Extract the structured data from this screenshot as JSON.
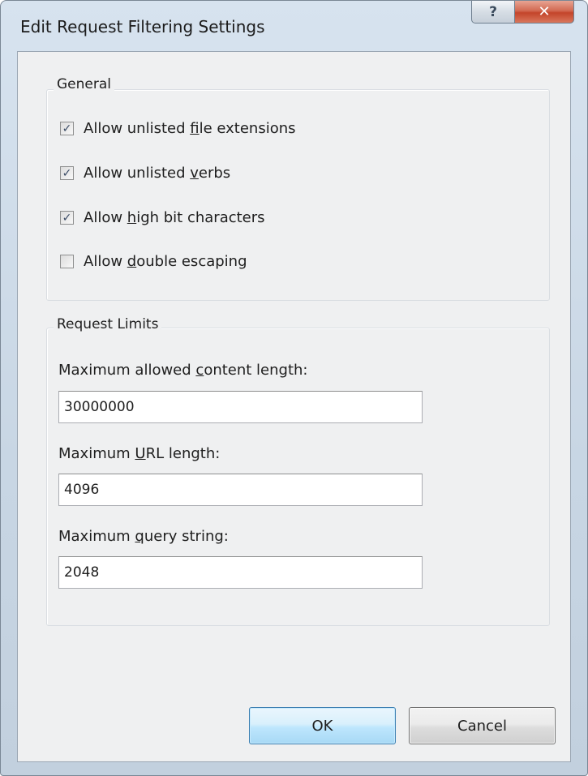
{
  "window": {
    "title": "Edit Request Filtering Settings",
    "help_glyph": "?",
    "close_glyph": "✕"
  },
  "general": {
    "label": "General",
    "options": [
      {
        "pre": "Allow unlisted ",
        "key": "f",
        "post": "ile extensions",
        "checked": true
      },
      {
        "pre": "Allow unlisted ",
        "key": "v",
        "post": "erbs",
        "checked": true
      },
      {
        "pre": "Allow ",
        "key": "h",
        "post": "igh bit characters",
        "checked": true
      },
      {
        "pre": "Allow ",
        "key": "d",
        "post": "ouble escaping",
        "checked": false
      }
    ]
  },
  "limits": {
    "label": "Request Limits",
    "fields": [
      {
        "pre": "Maximum allowed ",
        "key": "c",
        "post": "ontent length:",
        "value": "30000000"
      },
      {
        "pre": "Maximum ",
        "key": "U",
        "post": "RL length:",
        "value": "4096"
      },
      {
        "pre": "Maximum ",
        "key": "q",
        "post": "uery string:",
        "value": "2048"
      }
    ]
  },
  "buttons": {
    "ok": "OK",
    "cancel": "Cancel"
  },
  "colors": {
    "check_mark": "#3b4c66",
    "ok_border": "#3c7fb1",
    "close_red": "#c4442a"
  }
}
